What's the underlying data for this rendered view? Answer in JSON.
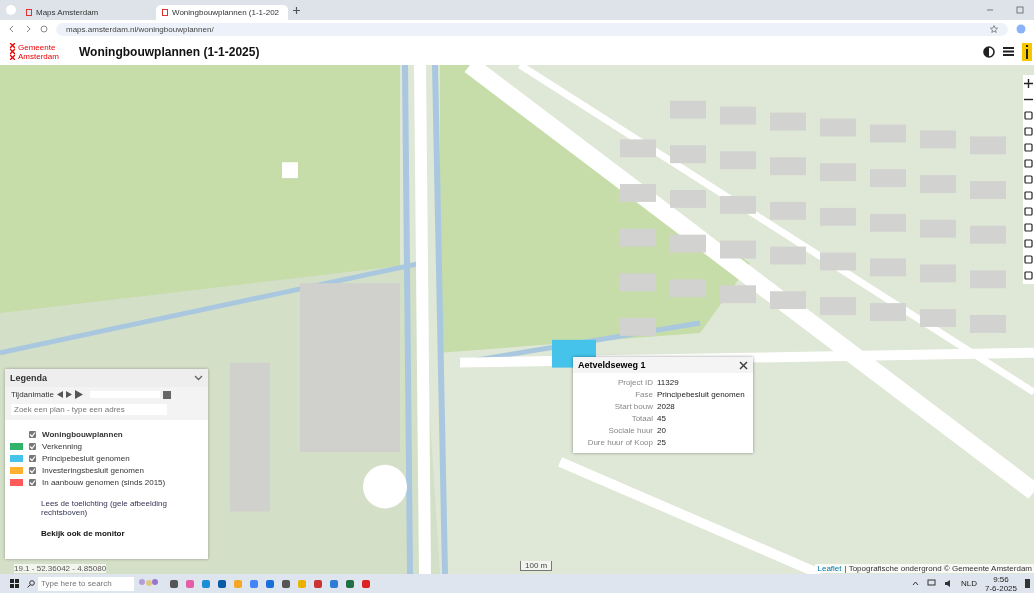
{
  "browser": {
    "tabs": [
      {
        "label": "Maps Amsterdam",
        "selected": false
      },
      {
        "label": "Woningbouwplannen (1-1-202",
        "selected": true
      }
    ],
    "url": "maps.amsterdam.nl/woningbouwplannen/"
  },
  "header": {
    "logo": [
      "Gemeente",
      "Amsterdam"
    ],
    "title": "Woningbouwplannen (1-1-2025)"
  },
  "legend": {
    "title": "Legenda",
    "animation_label": "Tijdanimatie",
    "search": {
      "placeholder": "Zoek een plan - type een adres"
    },
    "items": [
      {
        "label": "Woningbouwplannen",
        "checked": true,
        "kind": "group"
      },
      {
        "label": "Verkenning",
        "checked": true,
        "kind": "layer",
        "color": "#2fb36b"
      },
      {
        "label": "Principebesluit genomen",
        "checked": true,
        "kind": "layer",
        "color": "#45c3ea"
      },
      {
        "label": "Investeringsbesluit genomen",
        "checked": true,
        "kind": "layer",
        "color": "#ffb02e"
      },
      {
        "label": "In aanbouw genomen (sinds 2015)",
        "checked": true,
        "kind": "layer",
        "color": "#ff5a5a"
      }
    ],
    "note": "Lees de toelichting (gele afbeelding rechtsboven)",
    "link": "Bekijk ook de monitor"
  },
  "popup": {
    "title": "Aetveldseweg 1",
    "rows": [
      {
        "label": "Project ID",
        "value": "11329"
      },
      {
        "label": "Fase",
        "value": "Principebesluit genomen"
      },
      {
        "label": "Start bouw",
        "value": "2028"
      },
      {
        "label": "Totaal",
        "value": "45"
      },
      {
        "label": "Sociale huur",
        "value": "20"
      },
      {
        "label": "Dure huur of Koop",
        "value": "25"
      }
    ]
  },
  "map": {
    "coordinates": "19.1 - 52.36042 - 4.85080",
    "scale": "100 m",
    "attribution_link": "Leaflet",
    "attribution": "| Topografische ondergrond © Gemeente Amsterdam"
  },
  "taskbar": {
    "search": {
      "placeholder": "Type here to search"
    },
    "language": "NLD",
    "time": "9:56",
    "date": "7-6-2025"
  }
}
